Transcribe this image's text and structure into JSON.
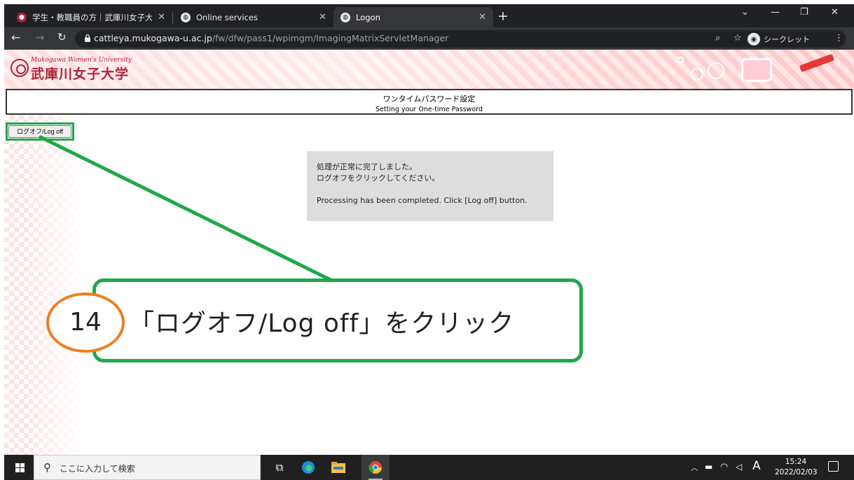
{
  "browser": {
    "tabs": [
      {
        "title": "学生・教職員の方｜武庫川女子大",
        "favicon": "university-logo-icon"
      },
      {
        "title": "Online services",
        "favicon": "globe-icon"
      },
      {
        "title": "Logon",
        "favicon": "globe-icon",
        "active": true
      }
    ],
    "url_host": "cattleya.mukogawa-u.ac.jp",
    "url_path": "/fw/dfw/pass1/wpimgm/ImagingMatrixServletManager",
    "incognito_label": "シークレット"
  },
  "site": {
    "logo_en": "Mukogawa Women's University",
    "logo_jp": "武庫川女子大学",
    "brand_color": "#b0243a"
  },
  "page": {
    "title_jp": "ワンタイムパスワード設定",
    "title_en": "Setting your One-time Password",
    "logoff_button": "ログオフ/Log off",
    "message_line1": "処理が正常に完了しました。",
    "message_line2": "ログオフをクリックしてください。",
    "message_line3": "Processing has been completed. Click [Log off] button."
  },
  "annotation": {
    "step_number": "14",
    "instruction": "「ログオフ/Log off」をクリック",
    "highlight_color": "#1fa84a",
    "step_circle_color": "#f07d1e"
  },
  "taskbar": {
    "search_placeholder": "ここに入力して検索",
    "ime_indicator": "A",
    "time": "15:24",
    "date": "2022/02/03"
  }
}
